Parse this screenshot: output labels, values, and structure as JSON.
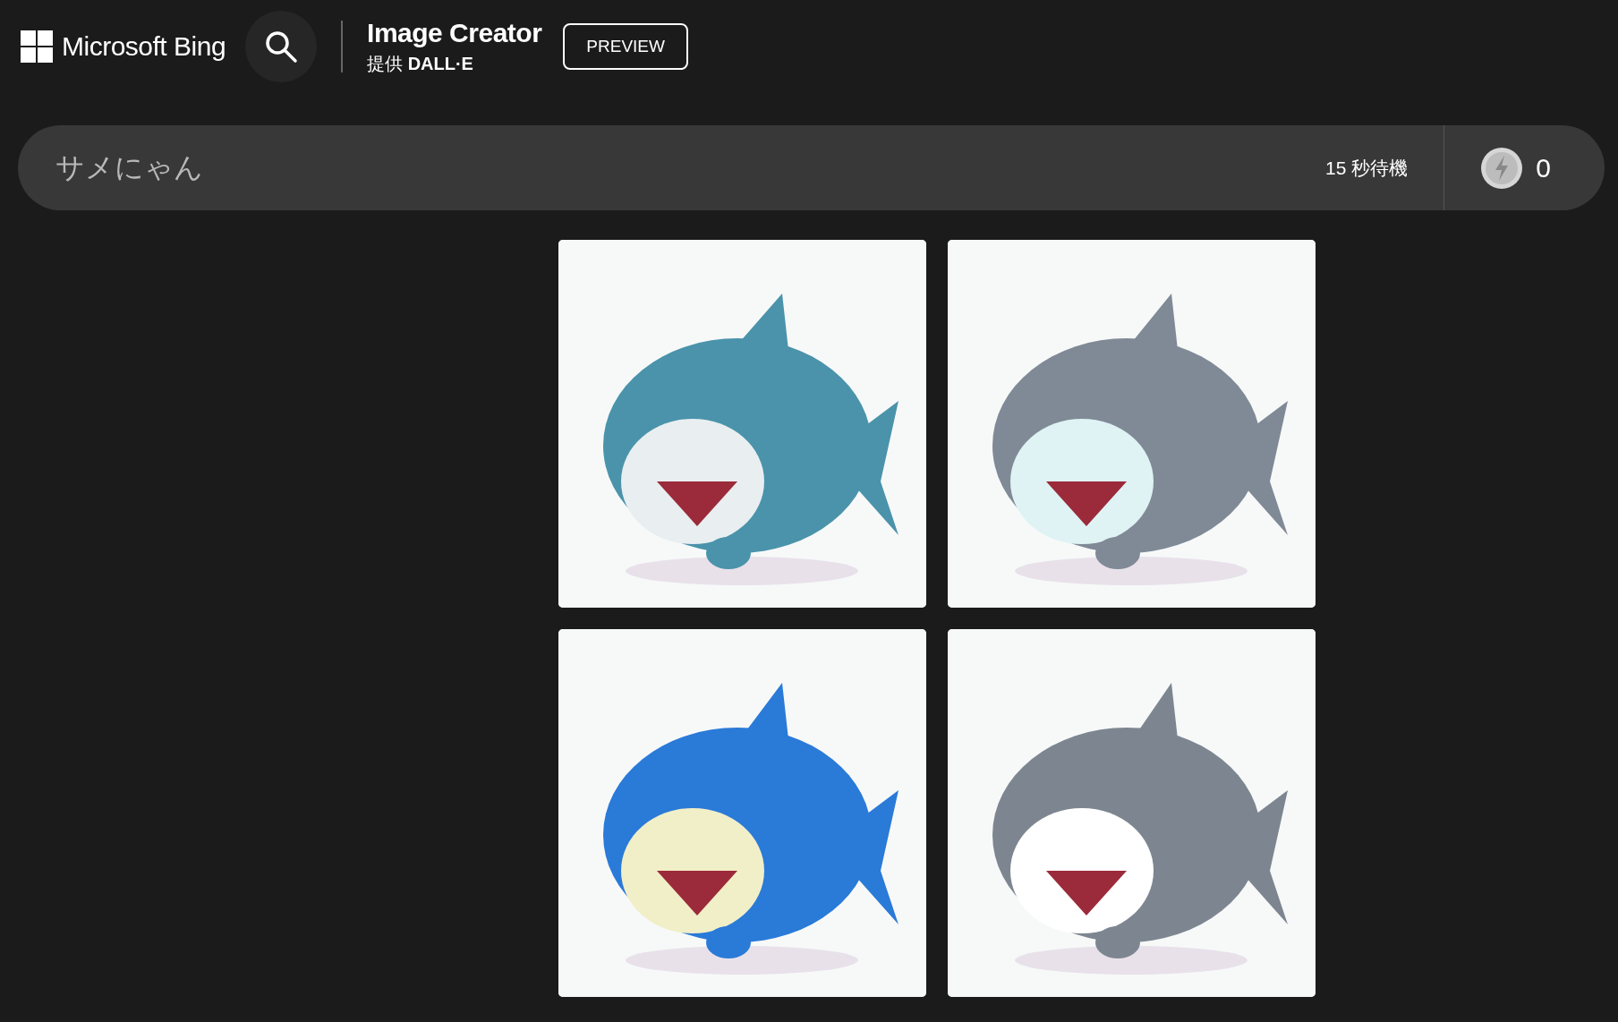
{
  "header": {
    "brand": "Microsoft Bing",
    "title": "Image Creator",
    "subtitle": "提供 **DALL·E**",
    "badge": "PREVIEW"
  },
  "prompt": {
    "value": "サメにゃん",
    "status": "15 秒待機",
    "boosts": "0"
  }
}
